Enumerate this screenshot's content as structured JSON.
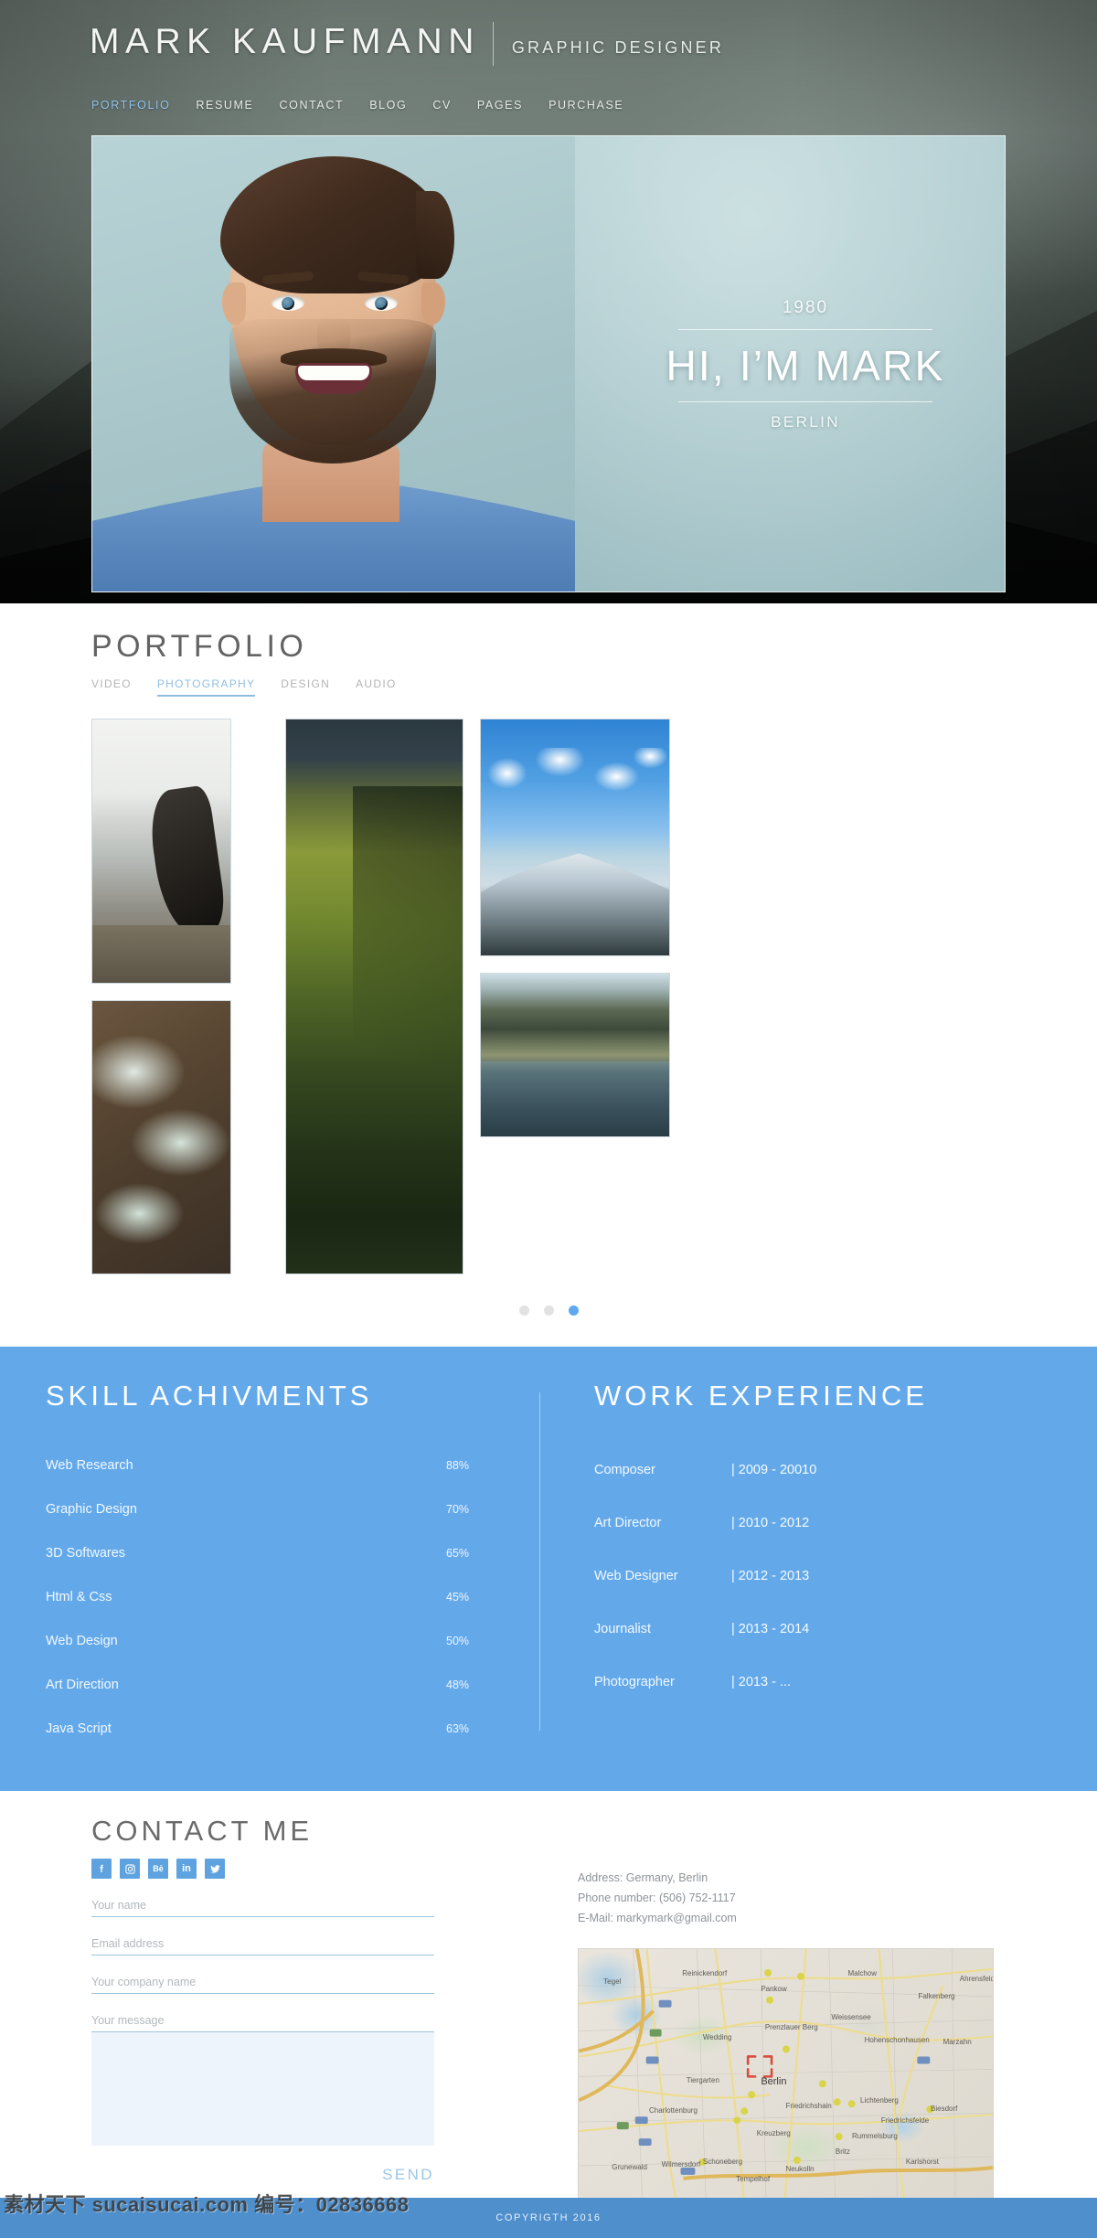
{
  "header": {
    "brand_name": "MARK KAUFMANN",
    "brand_role": "GRAPHIC DESIGNER",
    "nav": [
      {
        "label": "PORTFOLIO",
        "active": true
      },
      {
        "label": "RESUME",
        "active": false
      },
      {
        "label": "CONTACT",
        "active": false
      },
      {
        "label": "BLOG",
        "active": false
      },
      {
        "label": "CV",
        "active": false
      },
      {
        "label": "PAGES",
        "active": false
      },
      {
        "label": "PURCHASE",
        "active": false
      }
    ]
  },
  "hero": {
    "year": "1980",
    "title": "HI, I’M MARK",
    "city": "BERLIN"
  },
  "portfolio": {
    "title": "PORTFOLIO",
    "filters": [
      {
        "label": "VIDEO",
        "active": false
      },
      {
        "label": "PHOTOGRAPHY",
        "active": true
      },
      {
        "label": "DESIGN",
        "active": false
      },
      {
        "label": "AUDIO",
        "active": false
      }
    ],
    "tiles": [
      {
        "name": "photographer-on-ice"
      },
      {
        "name": "braided-river-aerial"
      },
      {
        "name": "green-mossy-mountain"
      },
      {
        "name": "snow-mountain-blue-sky"
      },
      {
        "name": "fjord-shoreline"
      }
    ],
    "carousel_dots": [
      {
        "active": false
      },
      {
        "active": false
      },
      {
        "active": true
      }
    ]
  },
  "skills": {
    "title": "SKILL ACHIVMENTS",
    "accent_color": "#63a9ea",
    "items": [
      {
        "label": "Web Research",
        "percent": 88,
        "percent_label": "88%"
      },
      {
        "label": "Graphic Design",
        "percent": 70,
        "percent_label": "70%"
      },
      {
        "label": "3D Softwares",
        "percent": 65,
        "percent_label": "65%"
      },
      {
        "label": "Html & Css",
        "percent": 45,
        "percent_label": "45%"
      },
      {
        "label": "Web Design",
        "percent": 50,
        "percent_label": "50%"
      },
      {
        "label": "Art Direction",
        "percent": 48,
        "percent_label": "48%"
      },
      {
        "label": "Java Script",
        "percent": 63,
        "percent_label": "63%"
      }
    ]
  },
  "work": {
    "title": "WORK EXPERIENCE",
    "items": [
      {
        "role": "Composer",
        "years": "| 2009 - 20010"
      },
      {
        "role": "Art Director",
        "years": "| 2010 - 2012"
      },
      {
        "role": "Web Designer",
        "years": "| 2012 - 2013"
      },
      {
        "role": "Journalist",
        "years": "| 2013 - 2014"
      },
      {
        "role": "Photographer",
        "years": "| 2013 - ..."
      }
    ]
  },
  "contact": {
    "title": "CONTACT ME",
    "socials": [
      {
        "name": "facebook-icon",
        "glyph": "f"
      },
      {
        "name": "instagram-icon",
        "glyph": ""
      },
      {
        "name": "behance-icon",
        "glyph": "Bē"
      },
      {
        "name": "linkedin-icon",
        "glyph": "in"
      },
      {
        "name": "twitter-icon",
        "glyph": ""
      }
    ],
    "fields": [
      {
        "name": "name-field",
        "placeholder": "Your name"
      },
      {
        "name": "email-field",
        "placeholder": "Email address"
      },
      {
        "name": "company-field",
        "placeholder": "Your company name"
      }
    ],
    "message_placeholder": "Your message",
    "send_label": "SEND",
    "info": {
      "address": "Address: Germany, Berlin",
      "phone": "Phone number: (506) 752-1117",
      "email": "E-Mail: markymark@gmail.com"
    },
    "map_city": "Berlin",
    "map_labels": [
      "Tegel",
      "Reinickendorf",
      "Pankow",
      "Wedding",
      "Prenzlauer Berg",
      "Weissensee",
      "Hohenschonhausen",
      "Marzahn",
      "Charlottenburg",
      "Tiergarten",
      "Friedrichshain",
      "Lichtenberg",
      "Biesdorf",
      "Kreuzberg",
      "Schoneberg",
      "Neukolln",
      "Tempelhof",
      "Wilmersdorf",
      "Grunewald",
      "Friedrichsfelde",
      "Rummelsburg",
      "Britz",
      "Karlshorst",
      "Falkenberg",
      "Malchow",
      "Ahrensfelde"
    ]
  },
  "footer": {
    "copyright": "COPYRIGTH 2016"
  },
  "watermark": {
    "text": "素材天下 sucaisucai.com 编号：02836668"
  }
}
